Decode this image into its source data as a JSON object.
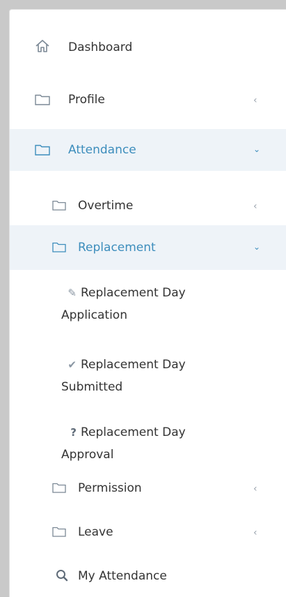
{
  "menu": {
    "dashboard": {
      "label": "Dashboard",
      "icon": "home-icon"
    },
    "profile": {
      "label": "Profile",
      "icon": "folder-icon",
      "chevron": "<"
    },
    "attendance": {
      "label": "Attendance",
      "icon": "folder-icon",
      "chevron": "v",
      "children": {
        "overtime": {
          "label": "Overtime",
          "icon": "folder-icon",
          "chevron": "<"
        },
        "replacement": {
          "label": "Replacement",
          "icon": "folder-icon",
          "chevron": "v",
          "children": [
            {
              "icon_glyph": "✎",
              "icon": "edit-icon",
              "line1": "Replacement Day",
              "line2": "Application"
            },
            {
              "icon_glyph": "✔",
              "icon": "check-icon",
              "line1": "Replacement Day",
              "line2": "Submitted"
            },
            {
              "icon_glyph": "?",
              "icon": "question-icon",
              "line1": "Replacement Day",
              "line2": "Approval"
            }
          ]
        },
        "permission": {
          "label": "Permission",
          "icon": "folder-icon",
          "chevron": "<"
        },
        "leave": {
          "label": "Leave",
          "icon": "folder-icon",
          "chevron": "<"
        },
        "my_attendance": {
          "label": "My Attendance",
          "icon": "search-icon"
        }
      }
    }
  },
  "colors": {
    "accent": "#3c8dbc",
    "active_bg": "#eef3f8",
    "badge_border": "#e3a629"
  }
}
